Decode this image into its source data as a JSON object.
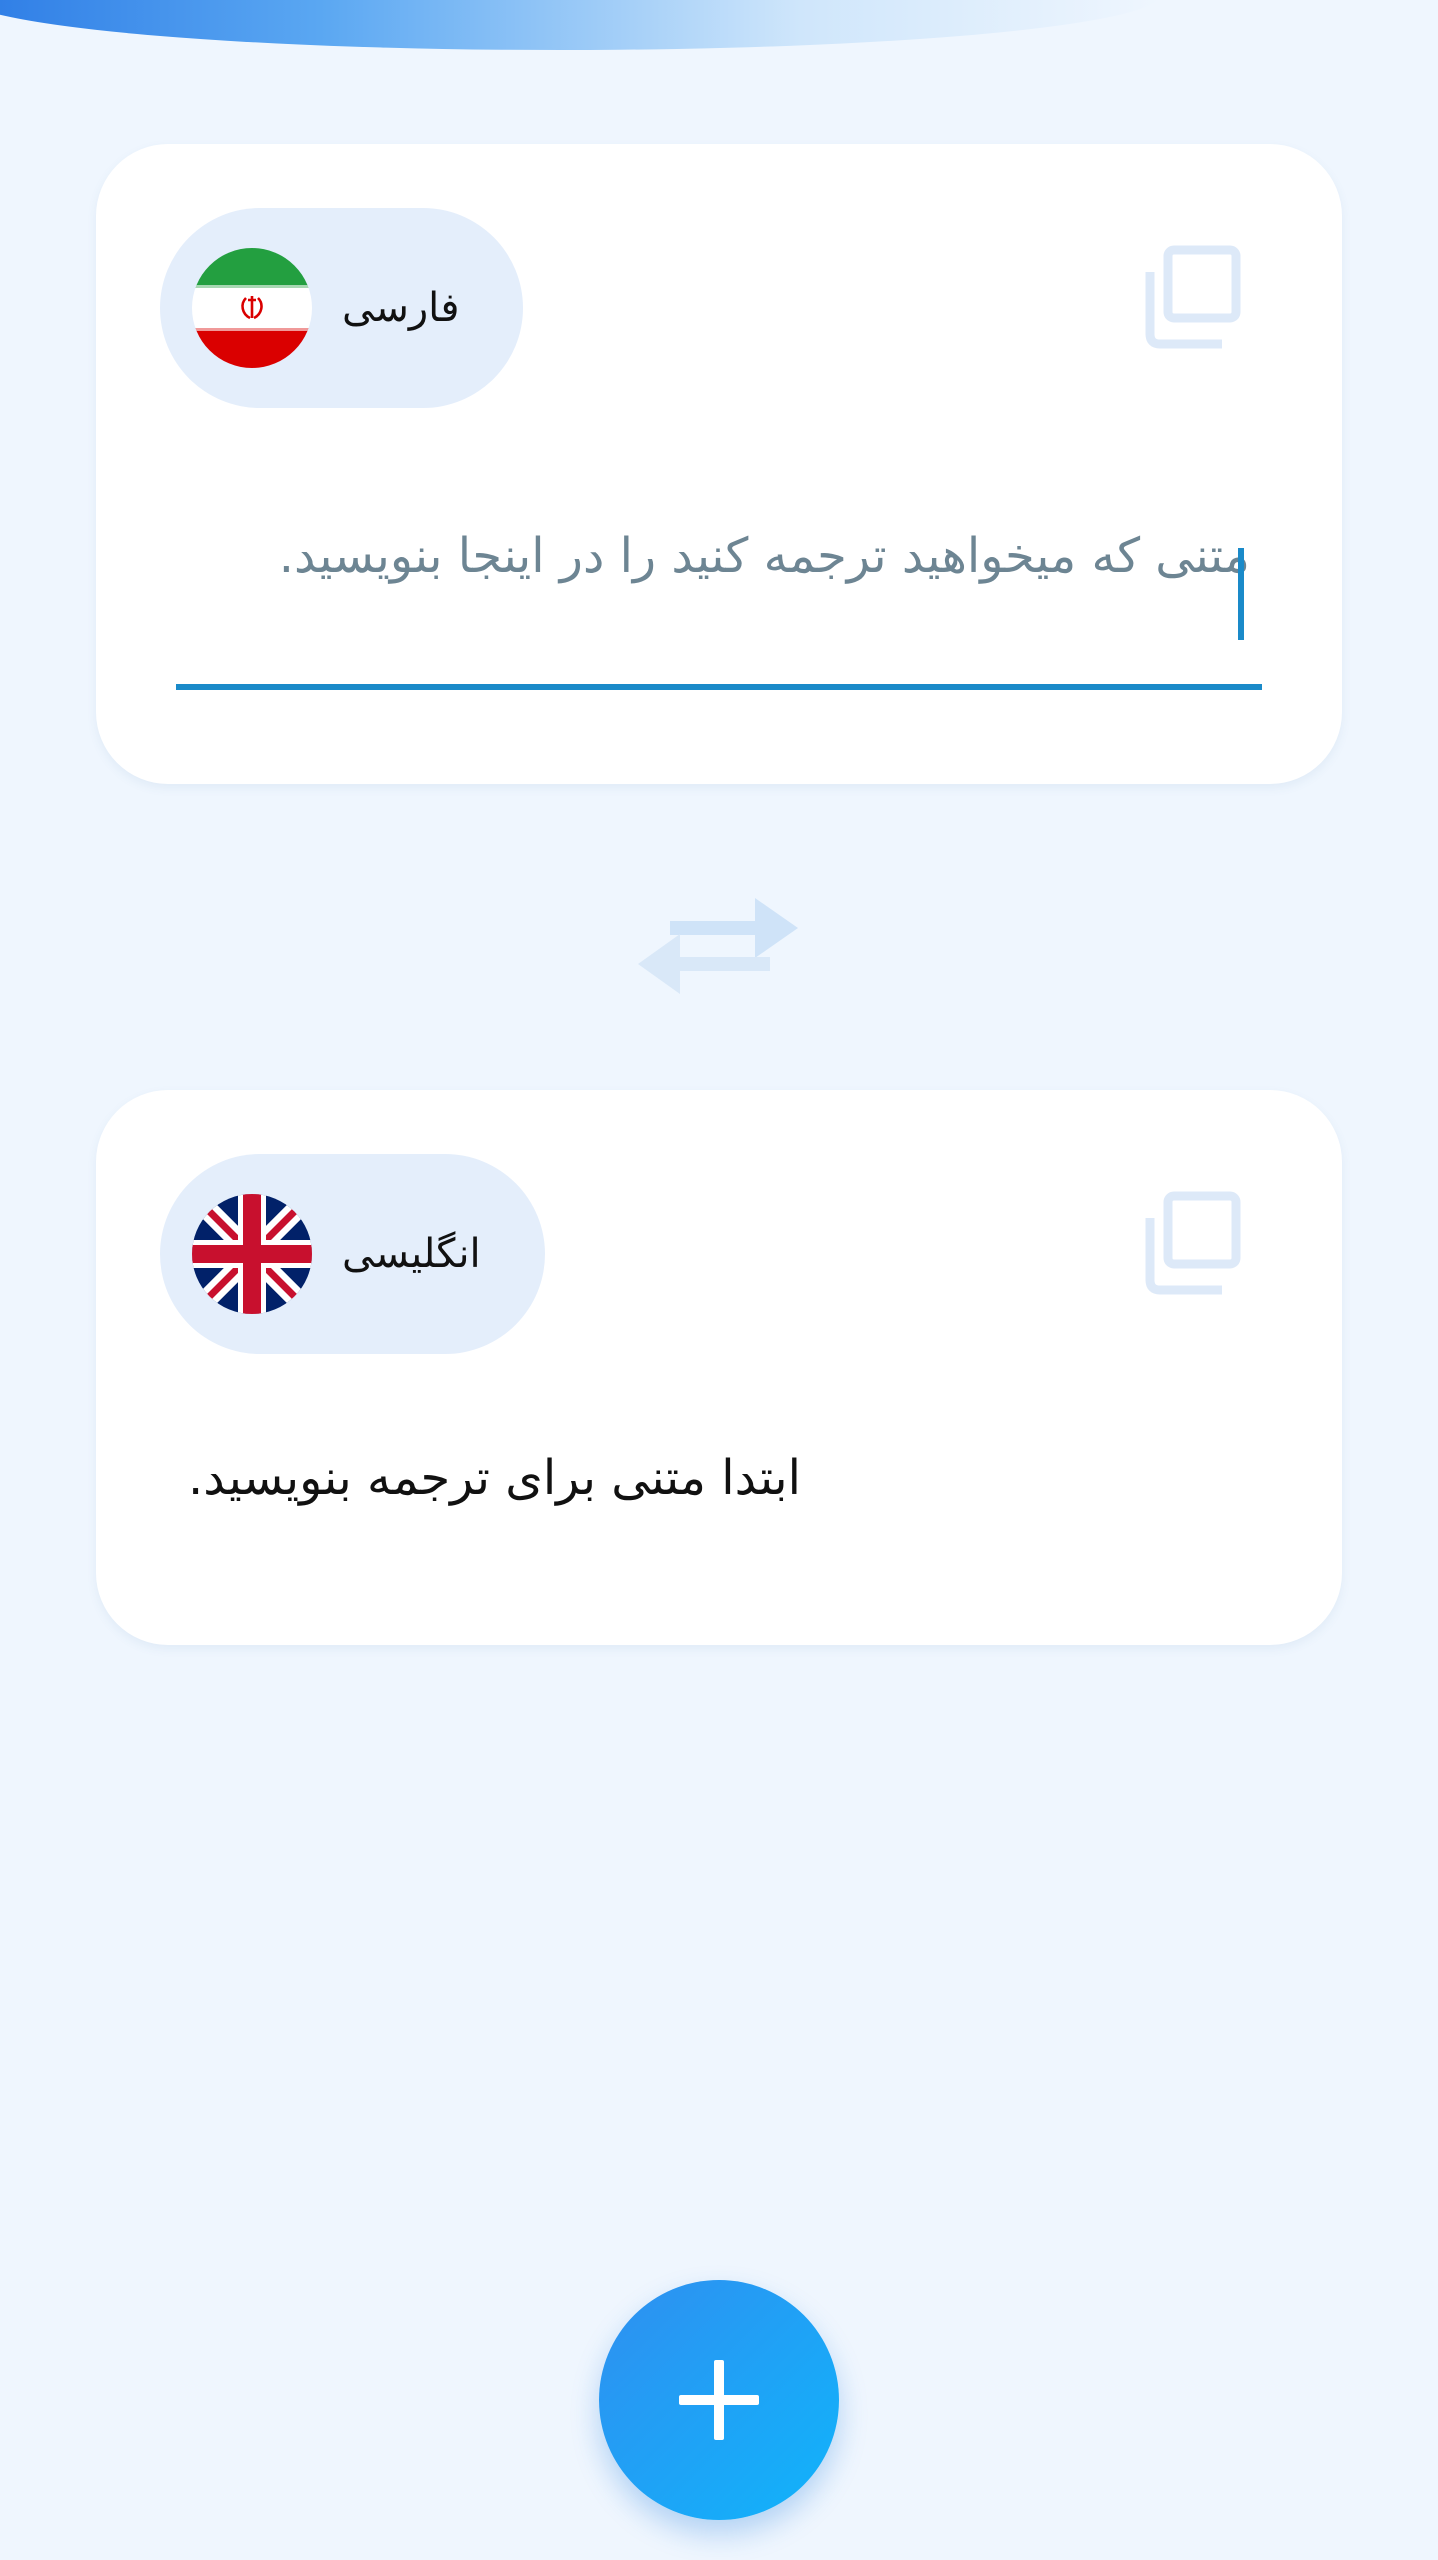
{
  "source_card": {
    "language_label": "فارسی",
    "flag": "iran-flag",
    "input_placeholder": "متنی که میخواهید ترجمه کنید را در اینجا بنویسید.",
    "input_value": "",
    "copy_icon": "copy-icon"
  },
  "swap": {
    "icon": "swap-arrows-icon"
  },
  "target_card": {
    "language_label": "انگلیسی",
    "flag": "uk-flag",
    "result_text": "ابتدا متنی برای ترجمه بنویسید.",
    "copy_icon": "copy-icon"
  },
  "fab": {
    "icon": "plus-icon"
  },
  "colors": {
    "background": "#eff6fe",
    "accent": "#1a8ac9",
    "chip": "#e4eefb",
    "fab_start": "#2f8ff0",
    "fab_end": "#10b4fb"
  }
}
